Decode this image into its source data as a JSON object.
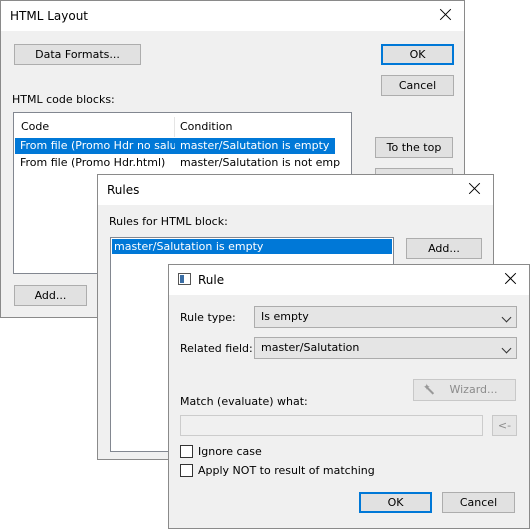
{
  "layout_window": {
    "title": "HTML Layout",
    "data_formats_label": "Data Formats...",
    "ok_label": "OK",
    "cancel_label": "Cancel",
    "code_blocks_label": "HTML code blocks:",
    "columns": [
      "Code",
      "Condition"
    ],
    "rows": [
      {
        "code": "From file (Promo Hdr no salut...",
        "condition": "master/Salutation is empty",
        "selected": true
      },
      {
        "code": "From file (Promo Hdr.html)",
        "condition": "master/Salutation is not empty",
        "selected": false
      }
    ],
    "to_top_label": "To the top",
    "add_label": "Add..."
  },
  "rules_window": {
    "title": "Rules",
    "rules_label": "Rules for HTML block:",
    "rules": [
      "master/Salutation is empty"
    ],
    "add_label": "Add..."
  },
  "rule_window": {
    "title": "Rule",
    "rule_type_label": "Rule type:",
    "rule_type_value": "Is empty",
    "related_field_label": "Related field:",
    "related_field_value": "master/Salutation",
    "wizard_label": "Wizard...",
    "match_label": "Match (evaluate) what:",
    "match_value": "",
    "arrow_label": "<-",
    "ignore_case_label": "Ignore case",
    "apply_not_label": "Apply NOT to result of matching",
    "ok_label": "OK",
    "cancel_label": "Cancel"
  },
  "colors": {
    "selection": "#0078d7",
    "window_bg": "#f0f0f0"
  }
}
